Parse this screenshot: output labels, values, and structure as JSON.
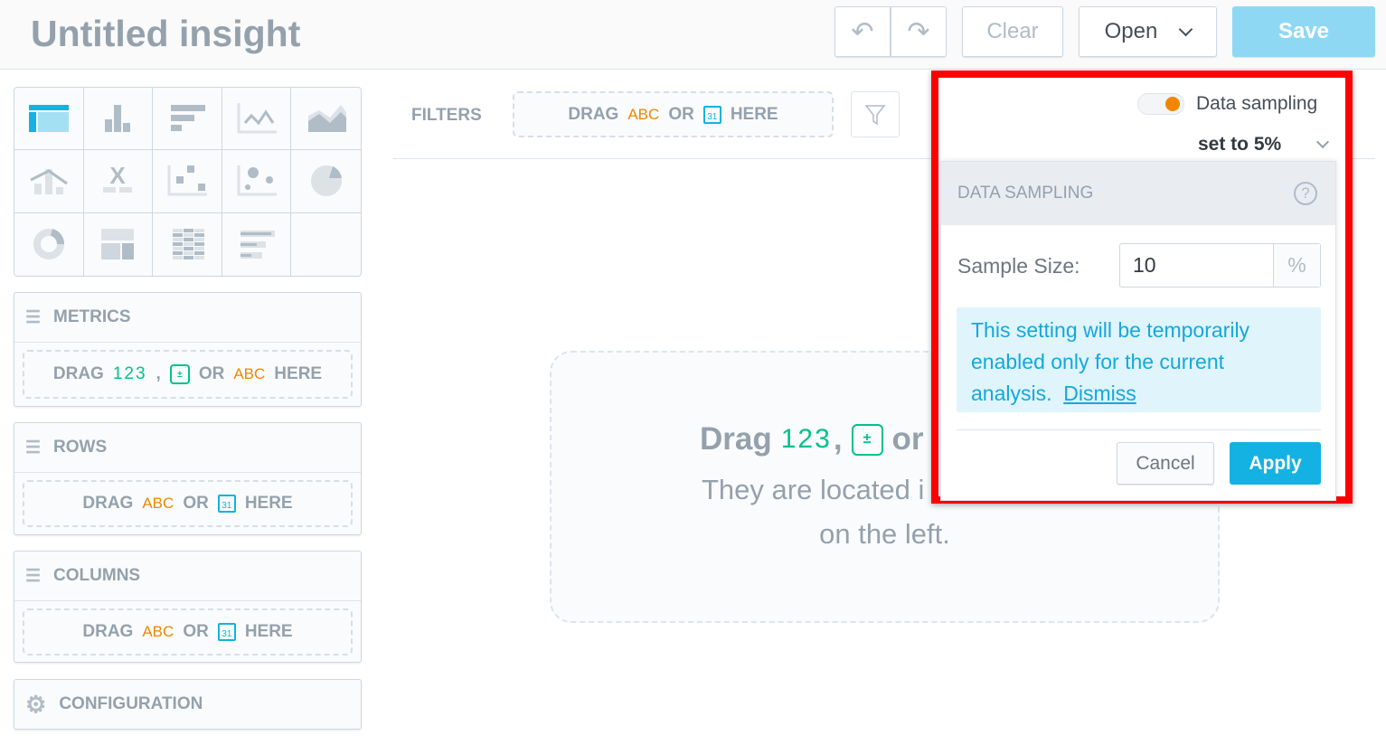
{
  "header": {
    "title": "Untitled insight",
    "clear": "Clear",
    "open": "Open",
    "save": "Save"
  },
  "chart_types": [
    "table",
    "column",
    "bar",
    "line",
    "area",
    "combo",
    "headline",
    "scatter",
    "bubble",
    "pie",
    "donut",
    "treemap",
    "heatmap",
    "bullet"
  ],
  "sidebar": {
    "metrics": {
      "label": "METRICS",
      "drag": "DRAG",
      "num": "123",
      "comma": ",",
      "or": "OR",
      "abc": "ABC",
      "here": "HERE"
    },
    "rows": {
      "label": "ROWS",
      "drag": "DRAG",
      "abc": "ABC",
      "or": "OR",
      "cal": "31",
      "here": "HERE"
    },
    "columns": {
      "label": "COLUMNS",
      "drag": "DRAG",
      "abc": "ABC",
      "or": "OR",
      "cal": "31",
      "here": "HERE"
    },
    "configuration": {
      "label": "CONFIGURATION"
    }
  },
  "filters": {
    "label": "FILTERS",
    "drag": "DRAG",
    "abc": "ABC",
    "or": "OR",
    "cal": "31",
    "here": "HERE"
  },
  "empty": {
    "drag": "Drag",
    "num": "123",
    "comma": ",",
    "or": "or",
    "line1": "They are located i",
    "line2": "on the left."
  },
  "sampling": {
    "toggle_label": "Data sampling",
    "toggle_on": true,
    "current": "set to 5%",
    "panel_title": "DATA SAMPLING",
    "sample_label": "Sample Size:",
    "sample_value": "10",
    "unit": "%",
    "info": "This setting will be temporarily enabled only for the current analysis.",
    "dismiss": "Dismiss",
    "cancel": "Cancel",
    "apply": "Apply"
  },
  "colors": {
    "accent": "#14b2e2",
    "highlight_frame": "#ff0000",
    "toggle": "#f18600",
    "metric": "#00c18d"
  }
}
